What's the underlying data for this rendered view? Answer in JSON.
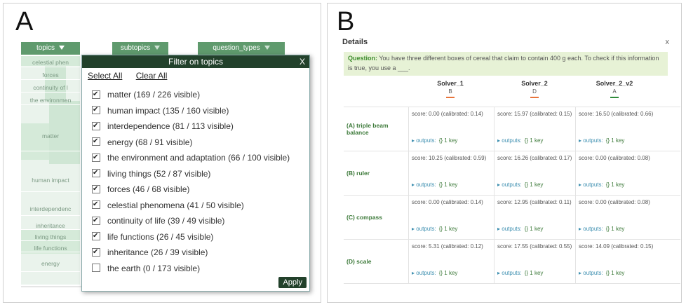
{
  "panel_a": {
    "letter": "A",
    "headers": {
      "topics": "topics",
      "subtopics": "subtopics",
      "question_types": "question_types"
    },
    "topic_cells": [
      "celestial phen",
      "forces",
      "continuity of l",
      "the environmen",
      "matter",
      "human impact",
      "interdependenc",
      "inheritance",
      "living things",
      "life functions",
      "energy"
    ],
    "popup": {
      "title": "Filter on topics",
      "close": "X",
      "select_all": "Select All",
      "clear_all": "Clear All",
      "apply": "Apply",
      "items": [
        {
          "label": "matter (169 / 226 visible)",
          "checked": true
        },
        {
          "label": "human impact (135 / 160 visible)",
          "checked": true
        },
        {
          "label": "interdependence (81 / 113 visible)",
          "checked": true
        },
        {
          "label": "energy (68 / 91 visible)",
          "checked": true
        },
        {
          "label": "the environment and adaptation (66 / 100 visible)",
          "checked": true
        },
        {
          "label": "living things (52 / 87 visible)",
          "checked": true
        },
        {
          "label": "forces (46 / 68 visible)",
          "checked": true
        },
        {
          "label": "celestial phenomena (41 / 50 visible)",
          "checked": true
        },
        {
          "label": "continuity of life (39 / 49 visible)",
          "checked": true
        },
        {
          "label": "life functions (26 / 45 visible)",
          "checked": true
        },
        {
          "label": "inheritance (26 / 39 visible)",
          "checked": true
        },
        {
          "label": "the earth (0 / 173 visible)",
          "checked": false
        }
      ]
    }
  },
  "panel_b": {
    "letter": "B",
    "details_title": "Details",
    "close": "x",
    "question_label": "Question:",
    "question_text": "You have three different boxes of cereal that claim to contain 400 g each. To check if this information is true, you use a ___.",
    "solvers": [
      {
        "name": "Solver_1",
        "answer": "B",
        "color": "#e8743b"
      },
      {
        "name": "Solver_2",
        "answer": "D",
        "color": "#e8743b"
      },
      {
        "name": "Solver_2_v2",
        "answer": "A",
        "color": "#2e8b3a"
      }
    ],
    "rows": [
      {
        "label": "(A) triple beam balance",
        "cells": [
          {
            "score": "score: 0.00 (calibrated: 0.14)",
            "outputs": "outputs:",
            "key": "{} 1 key"
          },
          {
            "score": "score: 15.97 (calibrated: 0.15)",
            "outputs": "outputs:",
            "key": "{} 1 key"
          },
          {
            "score": "score: 16.50 (calibrated: 0.66)",
            "outputs": "outputs:",
            "key": "{} 1 key"
          }
        ]
      },
      {
        "label": "(B) ruler",
        "cells": [
          {
            "score": "score: 10.25 (calibrated: 0.59)",
            "outputs": "outputs:",
            "key": "{} 1 key"
          },
          {
            "score": "score: 16.26 (calibrated: 0.17)",
            "outputs": "outputs:",
            "key": "{} 1 key"
          },
          {
            "score": "score: 0.00 (calibrated: 0.08)",
            "outputs": "outputs:",
            "key": "{} 1 key"
          }
        ]
      },
      {
        "label": "(C) compass",
        "cells": [
          {
            "score": "score: 0.00 (calibrated: 0.14)",
            "outputs": "outputs:",
            "key": "{} 1 key"
          },
          {
            "score": "score: 12.95 (calibrated: 0.11)",
            "outputs": "outputs:",
            "key": "{} 1 key"
          },
          {
            "score": "score: 0.00 (calibrated: 0.08)",
            "outputs": "outputs:",
            "key": "{} 1 key"
          }
        ]
      },
      {
        "label": "(D) scale",
        "cells": [
          {
            "score": "score: 5.31 (calibrated: 0.12)",
            "outputs": "outputs:",
            "key": "{} 1 key"
          },
          {
            "score": "score: 17.55 (calibrated: 0.55)",
            "outputs": "outputs:",
            "key": "{} 1 key"
          },
          {
            "score": "score: 14.09 (calibrated: 0.15)",
            "outputs": "outputs:",
            "key": "{} 1 key"
          }
        ]
      }
    ]
  },
  "colors": {
    "header_green": "#5f9a6d",
    "popup_title": "#22412b",
    "question_bg": "#e7f2d6",
    "row_label": "#3d7a3a"
  }
}
